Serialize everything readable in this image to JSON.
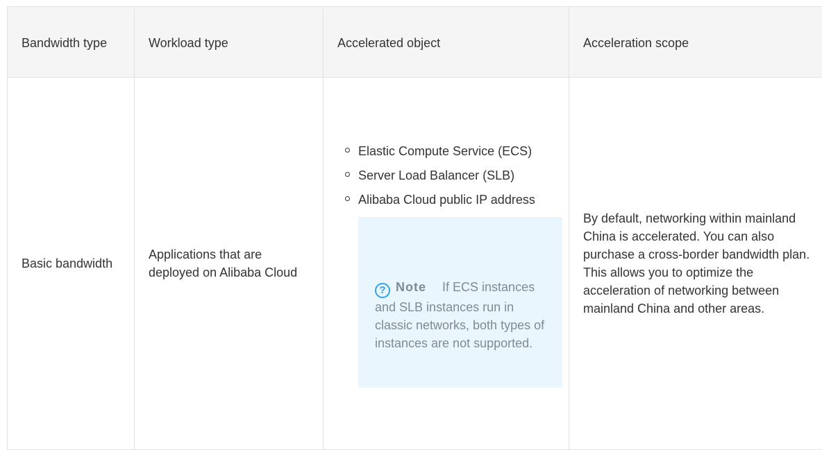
{
  "table": {
    "headers": [
      "Bandwidth type",
      "Workload type",
      "Accelerated object",
      "Acceleration scope"
    ],
    "row": {
      "bandwidth_type": "Basic bandwidth",
      "workload_type": "Applications that are deployed on Alibaba Cloud",
      "accelerated_objects": [
        "Elastic Compute Service (ECS)",
        "Server Load Balancer (SLB)",
        "Alibaba Cloud public IP address"
      ],
      "note": {
        "icon": "question-circle-icon",
        "label": "Note",
        "text": "If ECS instances and SLB instances run in classic networks, both types of instances are not supported."
      },
      "acceleration_scope": "By default, networking within mainland China is accelerated. You can also purchase a cross-border bandwidth plan. This allows you to optimize the acceleration of networking between mainland China and other areas."
    }
  },
  "colors": {
    "header_bg": "#f5f5f5",
    "border": "#e3e3e3",
    "note_bg": "#e9f6fd",
    "note_icon": "#2fa2ea",
    "note_text": "#818a91"
  }
}
